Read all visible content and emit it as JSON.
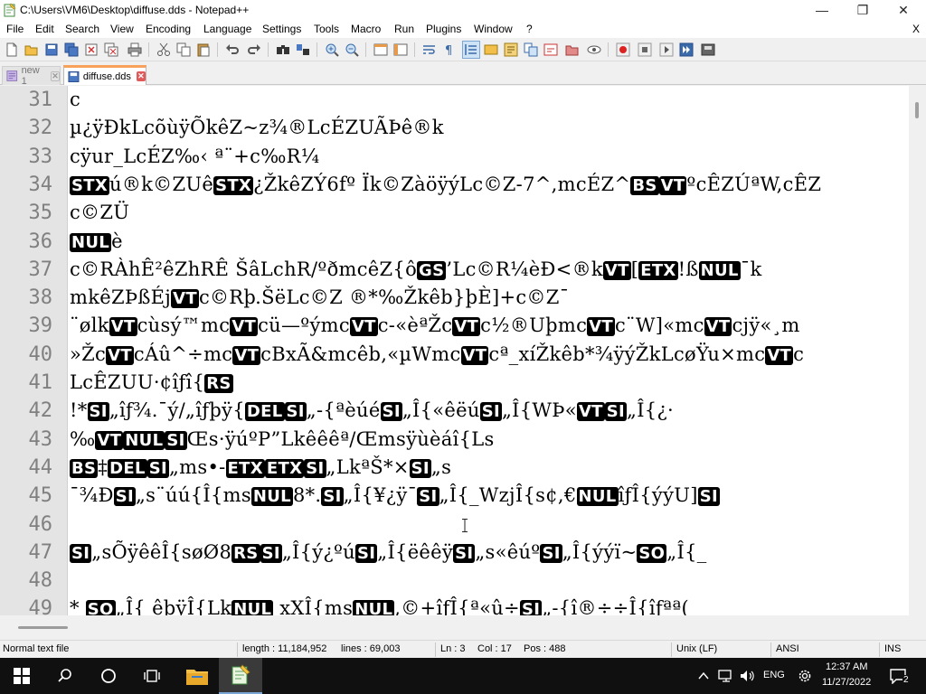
{
  "window": {
    "title": "C:\\Users\\VM6\\Desktop\\diffuse.dds - Notepad++",
    "minimize_glyph": "—",
    "maximize_glyph": "❐",
    "close_glyph": "✕"
  },
  "menu": {
    "items": [
      "File",
      "Edit",
      "Search",
      "View",
      "Encoding",
      "Language",
      "Settings",
      "Tools",
      "Macro",
      "Run",
      "Plugins",
      "Window",
      "?"
    ],
    "close_doc": "X"
  },
  "tabs": [
    {
      "label": "new 1",
      "active": false
    },
    {
      "label": "diffuse.dds",
      "active": true
    }
  ],
  "tab_close_glyph": "✕",
  "editor": {
    "lines": [
      {
        "num": "31",
        "segs": [
          {
            "t": "c"
          }
        ]
      },
      {
        "num": "32",
        "segs": [
          {
            "t": "µ¿ÿÐkLcõùÿÕkêZ~z¾®LcÉZUÃÞê®k"
          }
        ]
      },
      {
        "num": "33",
        "segs": [
          {
            "t": "cÿur_LcÉZ‰‹ ª¨+c‰R¼"
          }
        ]
      },
      {
        "num": "34",
        "segs": [
          {
            "c": "STX"
          },
          {
            "t": "ú®k©ZUê"
          },
          {
            "c": "STX"
          },
          {
            "t": "¿ŽkêZÝ6fº Ïk©ZàöÿýLc©Z-7^,mcÉZ^"
          },
          {
            "c": "BS"
          },
          {
            "c": "VT"
          },
          {
            "t": "ºcÊZÚªW,cÊZ"
          }
        ]
      },
      {
        "num": "35",
        "segs": [
          {
            "t": "c©ZÜ"
          }
        ]
      },
      {
        "num": "36",
        "segs": [
          {
            "c": "NUL"
          },
          {
            "t": "è"
          }
        ]
      },
      {
        "num": "37",
        "segs": [
          {
            "t": "c©RÀhÊ²êZhRÊ     ŠâLchR/ºðmcêZ{ô"
          },
          {
            "c": "GS"
          },
          {
            "t": "’Lc©R¼èÐ<®k"
          },
          {
            "c": "VT"
          },
          {
            "t": "["
          },
          {
            "c": "ETX"
          },
          {
            "t": "!ß"
          },
          {
            "c": "NUL"
          },
          {
            "t": "¯k"
          }
        ]
      },
      {
        "num": "38",
        "segs": [
          {
            "t": "mkêZÞßÉj"
          },
          {
            "c": "VT"
          },
          {
            "t": "c©Rþ.ŠëLc©Z   ®*‰Žkêb}þÈ]+c©Z¯"
          }
        ]
      },
      {
        "num": "39",
        "segs": [
          {
            "t": "¨ølk"
          },
          {
            "c": "VT"
          },
          {
            "t": "cùsý™mc"
          },
          {
            "c": "VT"
          },
          {
            "t": "cü—ºýmc"
          },
          {
            "c": "VT"
          },
          {
            "t": "c-«èªŽc"
          },
          {
            "c": "VT"
          },
          {
            "t": "c½®Uþmc"
          },
          {
            "c": "VT"
          },
          {
            "t": "c¨W]«mc"
          },
          {
            "c": "VT"
          },
          {
            "t": "cjÿ«¸m"
          }
        ]
      },
      {
        "num": "40",
        "segs": [
          {
            "t": "»Žc"
          },
          {
            "c": "VT"
          },
          {
            "t": "cÁû^÷mc"
          },
          {
            "c": "VT"
          },
          {
            "t": "cBxÃ&mcêb,«µWmc"
          },
          {
            "c": "VT"
          },
          {
            "t": "cª_xíŽkêb*¾ÿýŽkLcøŸu×mc"
          },
          {
            "c": "VT"
          },
          {
            "t": "c"
          }
        ]
      },
      {
        "num": "41",
        "segs": [
          {
            "t": "LcÊZUU·¢îƒî{"
          },
          {
            "c": "RS"
          }
        ]
      },
      {
        "num": "42",
        "segs": [
          {
            "t": "!*"
          },
          {
            "c": "SI"
          },
          {
            "t": "„îƒ¾.¯ý/„îƒþÿ{"
          },
          {
            "c": "DEL"
          },
          {
            "c": "SI"
          },
          {
            "t": "„-{ªèúé"
          },
          {
            "c": "SI"
          },
          {
            "t": "„Î{«êëú"
          },
          {
            "c": "SI"
          },
          {
            "t": "„Î{WÞ«"
          },
          {
            "c": "VT"
          },
          {
            "c": "SI"
          },
          {
            "t": "„Î{¿·"
          }
        ]
      },
      {
        "num": "43",
        "segs": [
          {
            "t": "‰"
          },
          {
            "c": "VT"
          },
          {
            "c": "NUL"
          },
          {
            "c": "SI"
          },
          {
            "t": "Œs·ÿúºP”Lkêêêª/Œmsÿùèáî{Ls"
          }
        ]
      },
      {
        "num": "44",
        "segs": [
          {
            "c": "BS"
          },
          {
            "t": "‡"
          },
          {
            "c": "DEL"
          },
          {
            "c": "SI"
          },
          {
            "t": "„ms•-"
          },
          {
            "c": "ETX"
          },
          {
            "c": "ETX"
          },
          {
            "c": "SI"
          },
          {
            "t": "„LkªŠ*×"
          },
          {
            "c": "SI"
          },
          {
            "t": "„s"
          }
        ]
      },
      {
        "num": "45",
        "segs": [
          {
            "t": "¯¾Ð"
          },
          {
            "c": "SI"
          },
          {
            "t": "„s¨úú{Î{ms"
          },
          {
            "c": "NUL"
          },
          {
            "t": "8*."
          },
          {
            "c": "SI"
          },
          {
            "t": "„Î{¥¿ÿ¯"
          },
          {
            "c": "SI"
          },
          {
            "t": "„Î{_WzjÎ{s¢,€"
          },
          {
            "c": "NUL"
          },
          {
            "t": "îƒÎ{ýýU]"
          },
          {
            "c": "SI"
          }
        ]
      },
      {
        "num": "46",
        "segs": []
      },
      {
        "num": "47",
        "segs": [
          {
            "c": "SI"
          },
          {
            "t": "„sÕÿêêÎ{søØ8"
          },
          {
            "c": "RS"
          },
          {
            "c": "SI"
          },
          {
            "t": "„Î{ý¿ºú"
          },
          {
            "c": "SI"
          },
          {
            "t": "„Î{ëêêÿ"
          },
          {
            "c": "SI"
          },
          {
            "t": "„s«êúº"
          },
          {
            "c": "SI"
          },
          {
            "t": "„Î{ýýï~"
          },
          {
            "c": "SO"
          },
          {
            "t": "„Î{_"
          }
        ]
      },
      {
        "num": "48",
        "segs": []
      },
      {
        "num": "49",
        "segs": [
          {
            "t": "*   "
          },
          {
            "c": "SO"
          },
          {
            "t": "„Î{ êþÿÎ{Lk"
          },
          {
            "c": "NUL"
          },
          {
            "t": " xXÎ{ms"
          },
          {
            "c": "NUL"
          },
          {
            "t": ",©+îƒÎ{ª«û÷"
          },
          {
            "c": "SI"
          },
          {
            "t": "„-{î®÷÷Î{îƒªª("
          }
        ]
      }
    ]
  },
  "status": {
    "file_type": "Normal text file",
    "length": "length : 11,184,952",
    "lines": "lines : 69,003",
    "ln": "Ln : 3",
    "col": "Col : 17",
    "pos": "Pos : 488",
    "eol": "Unix (LF)",
    "encoding": "ANSI",
    "mode": "INS"
  },
  "taskbar": {
    "language": "ENG",
    "time": "12:37 AM",
    "date": "11/27/2022",
    "notification_count": "2"
  },
  "colors": {
    "tab_accent": "#f7a15a",
    "tab_close": "#e05a5a",
    "control_char_bg": "#000000",
    "gutter_bg": "#e4e4e4",
    "taskbar_bg": "#101010"
  }
}
